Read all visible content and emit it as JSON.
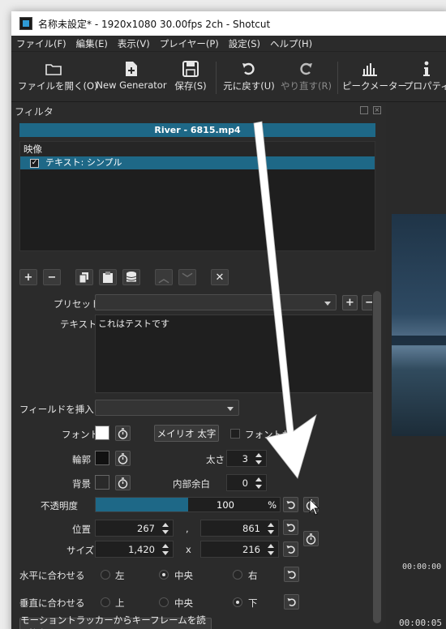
{
  "window": {
    "title": "名称未設定* - 1920x1080 30.00fps 2ch - Shotcut"
  },
  "menu": [
    "ファイル(F)",
    "編集(E)",
    "表示(V)",
    "プレイヤー(P)",
    "設定(S)",
    "ヘルプ(H)"
  ],
  "toolbar": {
    "open_file": "ファイルを開く(O)",
    "new_generator": "New Generator",
    "save": "保存(S)",
    "undo": "元に戻す(U)",
    "redo": "やり直す(R)",
    "peak_meter": "ピークメーター",
    "properties": "プロパティ"
  },
  "filters_dock": {
    "title": "フィルタ",
    "clip_name": "River - 6815.mp4",
    "group_video": "映像",
    "filter_item": "テキスト: シンプル",
    "filter_checked": "✓"
  },
  "form": {
    "preset_label": "プリセット",
    "text_label": "テキスト",
    "text_value": "これはテストです",
    "insert_field_label": "フィールドを挿入",
    "font_label": "フォント",
    "font_button": "メイリオ 太字",
    "font_size_label": "フォントサイズ",
    "outline_label": "輪郭",
    "thickness_label": "太さ",
    "thickness_value": "3",
    "background_label": "背景",
    "padding_label": "内部余白",
    "padding_value": "0",
    "opacity_label": "不透明度",
    "opacity_value": "100",
    "opacity_unit": "%",
    "opacity_level": 1.0,
    "position_label": "位置",
    "position_x": "267",
    "position_sep": ",",
    "position_y": "861",
    "size_label": "サイズ",
    "size_w": "1,420",
    "size_sep": "x",
    "size_h": "216",
    "halign_label": "水平に合わせる",
    "halign_left": "左",
    "halign_center": "中央",
    "halign_right": "右",
    "valign_label": "垂直に合わせる",
    "valign_top": "上",
    "valign_middle": "中央",
    "valign_bottom": "下",
    "motion_tracker_button": "モーショントラッカーからキーフレームを読み込む"
  },
  "timeline": {
    "ruler_time": "00:00:00",
    "timecode": "00:00:05"
  },
  "colors": {
    "accent": "#1e6887",
    "font_color": "#ffffff",
    "outline_color": "#111111",
    "background_color": "#2a2a2a"
  }
}
